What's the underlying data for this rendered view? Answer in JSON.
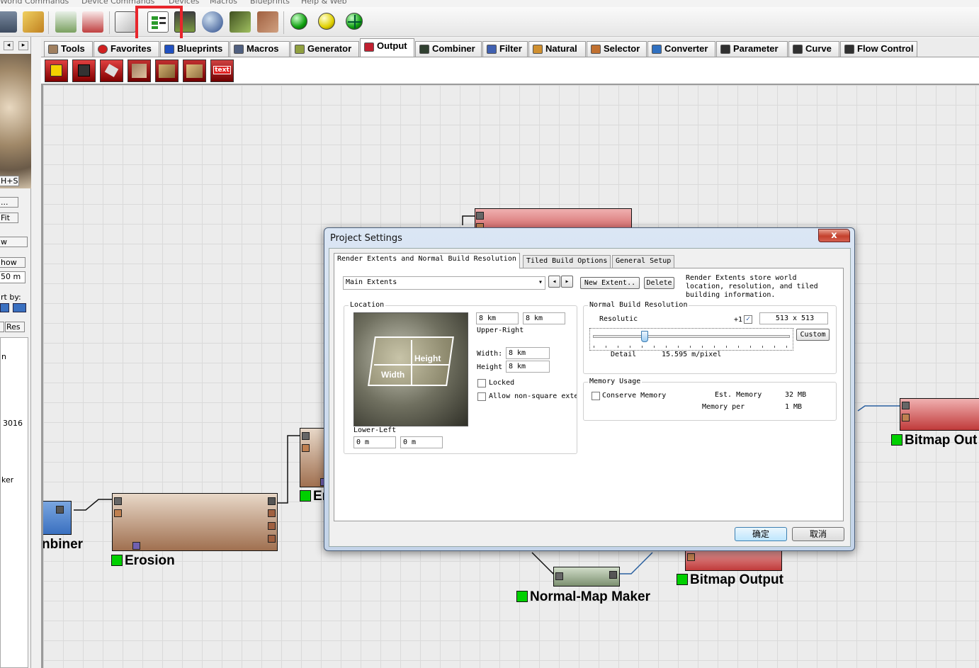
{
  "menu": [
    "World Commands",
    "Device Commands",
    "Devices",
    "Macros",
    "Blueprints",
    "Help & Web"
  ],
  "toolbar": {
    "buttons": [
      "save-icon",
      "fit-icon",
      "terrain-icon",
      "notes-icon",
      "dice-icon",
      "project-settings-icon",
      "filmstrip-icon",
      "globe-icon",
      "mountain-icon",
      "texture-icon"
    ],
    "balls": [
      "green-ball-icon",
      "yellow-ball-icon",
      "crosshair-ball-icon"
    ]
  },
  "left_panel": {
    "hotkey": "H+S",
    "btn_dots": "...",
    "fit": "Fit",
    "w": "w",
    "show": "how",
    "scale": "50 m",
    "sort_by": "rt by:",
    "res": "Res",
    "list_n": "n",
    "num": "3016",
    "maker": "ker"
  },
  "tabs": [
    {
      "label": "Tools",
      "icon": "tools-icon"
    },
    {
      "label": "Favorites",
      "icon": "heart-icon"
    },
    {
      "label": "Blueprints",
      "icon": "blueprint-icon"
    },
    {
      "label": "Macros",
      "icon": "macro-icon"
    },
    {
      "label": "Generator",
      "icon": "generator-icon"
    },
    {
      "label": "Output",
      "icon": "output-icon"
    },
    {
      "label": "Combiner",
      "icon": "combiner-icon"
    },
    {
      "label": "Filter",
      "icon": "filter-icon"
    },
    {
      "label": "Natural",
      "icon": "natural-icon"
    },
    {
      "label": "Selector",
      "icon": "selector-icon"
    },
    {
      "label": "Converter",
      "icon": "converter-icon"
    },
    {
      "label": "Parameter",
      "icon": "parameter-icon"
    },
    {
      "label": "Curve",
      "icon": "curve-icon"
    },
    {
      "label": "Flow Control",
      "icon": "flow-control-icon"
    }
  ],
  "tool_icons": {
    "items": [
      "save-output-icon",
      "disk-output-icon",
      "mesh-output-icon",
      "terrain-output-icon",
      "mountain-output-icon",
      "hills-output-icon"
    ],
    "text_badge": "text"
  },
  "nodes": {
    "combiner": "nbiner",
    "erosion": "Erosion",
    "erosion2": "Er",
    "normal_map": "Normal-Map Maker",
    "bitmap1": "Bitmap Output",
    "bitmap2": "Bitmap Out"
  },
  "dialog": {
    "title": "Project Settings",
    "close": "x",
    "tabs": [
      "Render Extents and Normal Build Resolution",
      "Tiled Build Options",
      "General Setup"
    ],
    "extent_select": "Main Extents",
    "new_extent": "New Extent..",
    "delete": "Delete",
    "info": [
      "Render Extents store world",
      "location, resolution, and tiled",
      "building information."
    ],
    "location": {
      "title": "Location",
      "height_label": "Height",
      "width_label": "Width",
      "ur_x": "8 km",
      "ur_y": "8 km",
      "upper_right": "Upper-Right",
      "width_text": "Width:",
      "width_val": "8 km",
      "height_text": "Height",
      "height_val": "8 km",
      "locked": "Locked",
      "allow": "Allow non-square exte",
      "lower_left": "Lower-Left",
      "ll_x": "0 m",
      "ll_y": "0 m"
    },
    "normal_build": {
      "title": "Normal Build Resolution",
      "res_label": "Resolutic",
      "plus1": "+1",
      "res_val": "513 x 513",
      "custom": "Custom",
      "detail": "Detail",
      "mpp": "15.595 m/pixel",
      "slider_fraction": 0.25
    },
    "memory": {
      "title": "Memory Usage",
      "conserve": "Conserve Memory",
      "est_label": "Est. Memory",
      "est_val": "32 MB",
      "per_label": "Memory per",
      "per_val": "1 MB"
    },
    "ok": "确定",
    "cancel": "取消"
  }
}
